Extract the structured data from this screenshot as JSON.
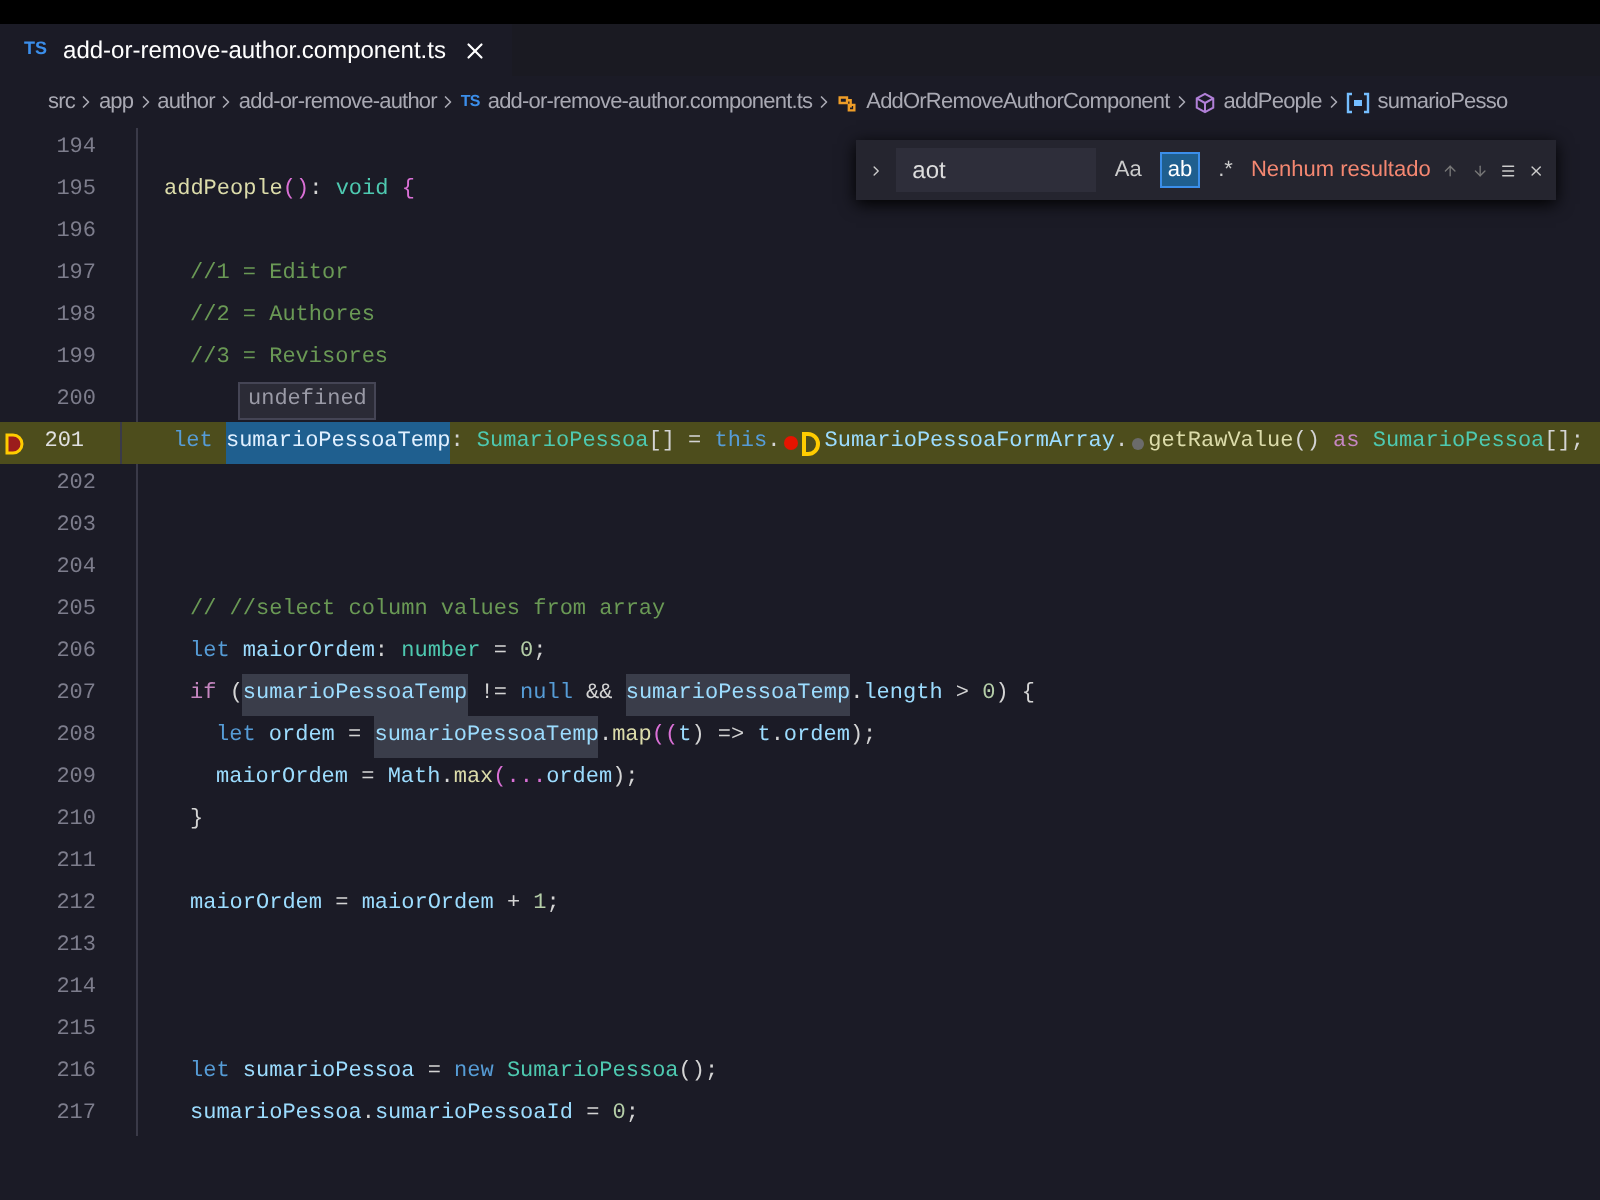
{
  "tab": {
    "file_icon": "TS",
    "title": "add-or-remove-author.component.ts",
    "selected": true
  },
  "breadcrumbs": [
    {
      "kind": "folder",
      "label": "src"
    },
    {
      "kind": "folder",
      "label": "app"
    },
    {
      "kind": "folder",
      "label": "author"
    },
    {
      "kind": "folder",
      "label": "add-or-remove-author"
    },
    {
      "kind": "file",
      "icon_text": "TS",
      "label": "add-or-remove-author.component.ts"
    },
    {
      "kind": "class",
      "label": "AddOrRemoveAuthorComponent"
    },
    {
      "kind": "method",
      "label": "addPeople"
    },
    {
      "kind": "variable",
      "label": "sumarioPesso"
    }
  ],
  "find": {
    "value": "aot",
    "options": [
      {
        "label": "Aa",
        "selected": false
      },
      {
        "label": "ab",
        "selected": true
      },
      {
        "label": ".*",
        "selected": false
      }
    ],
    "result": "Nenhum resultado"
  },
  "hover": {
    "text": "undefined"
  },
  "lines": [
    {
      "number": "194",
      "current": false,
      "hover": false
    },
    {
      "number": "195",
      "current": false,
      "hover": false,
      "kind": "flat",
      "tokens": [
        {
          "text": "addPeople",
          "kind": "func"
        },
        {
          "text": "()",
          "kind": "bracket"
        },
        {
          "text": ": ",
          "kind": "punct"
        },
        {
          "text": "void ",
          "kind": "type"
        },
        {
          "text": "{",
          "kind": "bracket"
        }
      ]
    },
    {
      "number": "196",
      "current": false,
      "hover": false
    },
    {
      "number": "197",
      "current": false,
      "hover": false,
      "kind": "inner",
      "tokens": [
        {
          "text": "//1 = Editor",
          "kind": "comment"
        }
      ]
    },
    {
      "number": "198",
      "current": false,
      "hover": false,
      "kind": "inner",
      "tokens": [
        {
          "text": "//2 = Authores",
          "kind": "comment"
        }
      ]
    },
    {
      "number": "199",
      "current": false,
      "hover": false,
      "kind": "inner",
      "tokens": [
        {
          "text": "//3 = Revisores",
          "kind": "comment"
        }
      ]
    },
    {
      "number": "200",
      "current": false,
      "hover": true
    },
    {
      "number": "201",
      "current": true,
      "hover": false,
      "kind": "inner",
      "tokens": [
        {
          "text": "let ",
          "kind": "kw"
        },
        {
          "text": "sumarioPessoaTemp",
          "kind": "match-active"
        },
        {
          "text": ": ",
          "kind": "punct"
        },
        {
          "text": "SumarioPessoa",
          "kind": "type"
        },
        {
          "text": "[] = ",
          "kind": "punct"
        },
        {
          "text": "this",
          "kind": "kw"
        },
        {
          "text": ".",
          "kind": "punct"
        },
        {
          "kind": "bp-dot"
        },
        {
          "kind": "bp-stop"
        },
        {
          "text": "SumarioPessoaFormArray",
          "kind": "ident"
        },
        {
          "text": ".",
          "kind": "punct"
        },
        {
          "kind": "bp-hint"
        },
        {
          "text": "getRawValue",
          "kind": "func"
        },
        {
          "text": "() ",
          "kind": "punct"
        },
        {
          "text": "as ",
          "kind": "ctrl"
        },
        {
          "text": "SumarioPessoa",
          "kind": "type"
        },
        {
          "text": "[];",
          "kind": "punct"
        }
      ]
    },
    {
      "number": "202",
      "current": false,
      "hover": false
    },
    {
      "number": "203",
      "current": false,
      "hover": false
    },
    {
      "number": "204",
      "current": false,
      "hover": false
    },
    {
      "number": "205",
      "current": false,
      "hover": false,
      "kind": "inner",
      "tokens": [
        {
          "text": "// //select column values from array",
          "kind": "comment"
        }
      ]
    },
    {
      "number": "206",
      "current": false,
      "hover": false,
      "kind": "inner",
      "tokens": [
        {
          "text": "let ",
          "kind": "kw"
        },
        {
          "text": "maiorOrdem",
          "kind": "ident"
        },
        {
          "text": ": ",
          "kind": "punct"
        },
        {
          "text": "number",
          "kind": "type"
        },
        {
          "text": " = ",
          "kind": "punct"
        },
        {
          "text": "0",
          "kind": "num"
        },
        {
          "text": ";",
          "kind": "punct"
        }
      ]
    },
    {
      "number": "207",
      "current": false,
      "hover": false,
      "kind": "inner",
      "tokens": [
        {
          "text": "if ",
          "kind": "ctrl"
        },
        {
          "text": "(",
          "kind": "punct"
        },
        {
          "text": "sumarioPessoaTemp",
          "kind": "match"
        },
        {
          "text": " != ",
          "kind": "punct"
        },
        {
          "text": "null",
          "kind": "kw"
        },
        {
          "text": " && ",
          "kind": "punct"
        },
        {
          "text": "sumarioPessoaTemp",
          "kind": "match"
        },
        {
          "text": ".",
          "kind": "punct"
        },
        {
          "text": "length",
          "kind": "ident"
        },
        {
          "text": " > ",
          "kind": "punct"
        },
        {
          "text": "0",
          "kind": "num"
        },
        {
          "text": ") {",
          "kind": "punct"
        }
      ]
    },
    {
      "number": "208",
      "current": false,
      "hover": false,
      "kind": "nested",
      "tokens": [
        {
          "text": "let ",
          "kind": "kw"
        },
        {
          "text": "ordem",
          "kind": "ident"
        },
        {
          "text": " = ",
          "kind": "punct"
        },
        {
          "text": "sumarioPessoaTemp",
          "kind": "match"
        },
        {
          "text": ".",
          "kind": "punct"
        },
        {
          "text": "map",
          "kind": "func"
        },
        {
          "text": "((",
          "kind": "bracket"
        },
        {
          "text": "t",
          "kind": "ident"
        },
        {
          "text": ") => ",
          "kind": "punct"
        },
        {
          "text": "t",
          "kind": "ident"
        },
        {
          "text": ".",
          "kind": "punct"
        },
        {
          "text": "ordem",
          "kind": "ident"
        },
        {
          "text": ");",
          "kind": "punct"
        }
      ]
    },
    {
      "number": "209",
      "current": false,
      "hover": false,
      "kind": "nested",
      "tokens": [
        {
          "text": "maiorOrdem",
          "kind": "ident"
        },
        {
          "text": " = ",
          "kind": "punct"
        },
        {
          "text": "Math",
          "kind": "ident"
        },
        {
          "text": ".",
          "kind": "punct"
        },
        {
          "text": "max",
          "kind": "func"
        },
        {
          "text": "(...",
          "kind": "bracket"
        },
        {
          "text": "ordem",
          "kind": "ident"
        },
        {
          "text": ");",
          "kind": "punct"
        }
      ]
    },
    {
      "number": "210",
      "current": false,
      "hover": false,
      "kind": "inner",
      "tokens": [
        {
          "text": "}",
          "kind": "punct"
        }
      ]
    },
    {
      "number": "211",
      "current": false,
      "hover": false
    },
    {
      "number": "212",
      "current": false,
      "hover": false,
      "kind": "inner",
      "tokens": [
        {
          "text": "maiorOrdem",
          "kind": "ident"
        },
        {
          "text": " = ",
          "kind": "punct"
        },
        {
          "text": "maiorOrdem",
          "kind": "ident"
        },
        {
          "text": " + ",
          "kind": "punct"
        },
        {
          "text": "1",
          "kind": "num"
        },
        {
          "text": ";",
          "kind": "punct"
        }
      ]
    },
    {
      "number": "213",
      "current": false,
      "hover": false
    },
    {
      "number": "214",
      "current": false,
      "hover": false
    },
    {
      "number": "215",
      "current": false,
      "hover": false
    },
    {
      "number": "216",
      "current": false,
      "hover": false,
      "kind": "inner",
      "tokens": [
        {
          "text": "let ",
          "kind": "kw"
        },
        {
          "text": "sumarioPessoa",
          "kind": "ident"
        },
        {
          "text": " = ",
          "kind": "punct"
        },
        {
          "text": "new ",
          "kind": "kw"
        },
        {
          "text": "SumarioPessoa",
          "kind": "type"
        },
        {
          "text": "();",
          "kind": "punct"
        }
      ]
    },
    {
      "number": "217",
      "current": false,
      "hover": false,
      "kind": "inner",
      "tokens": [
        {
          "text": "sumarioPessoa",
          "kind": "ident"
        },
        {
          "text": ".",
          "kind": "punct"
        },
        {
          "text": "sumarioPessoaId",
          "kind": "ident"
        },
        {
          "text": " = ",
          "kind": "punct"
        },
        {
          "text": "0",
          "kind": "num"
        },
        {
          "text": ";",
          "kind": "punct"
        }
      ]
    }
  ]
}
